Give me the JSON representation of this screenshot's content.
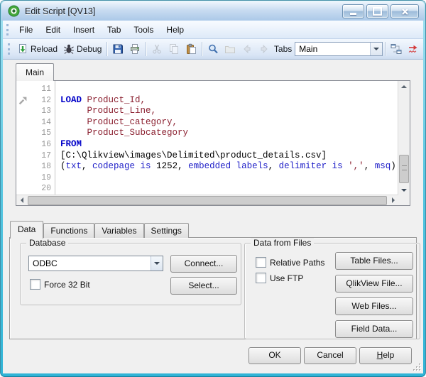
{
  "window": {
    "title": "Edit Script [QV13]",
    "controls": {
      "minimize": "minimize",
      "maximize": "maximize",
      "close": "close"
    }
  },
  "menu_bar": {
    "items": [
      "File",
      "Edit",
      "Insert",
      "Tab",
      "Tools",
      "Help"
    ]
  },
  "toolbar": {
    "groups": [
      [
        {
          "icon": "reload-icon",
          "label": "Reload",
          "enabled": true
        },
        {
          "icon": "debug-icon",
          "label": "Debug",
          "enabled": true
        }
      ],
      [
        {
          "icon": "save-icon",
          "enabled": true
        },
        {
          "icon": "print-icon",
          "enabled": true
        }
      ],
      [
        {
          "icon": "cut-icon",
          "enabled": false
        },
        {
          "icon": "copy-icon",
          "enabled": false
        },
        {
          "icon": "paste-icon",
          "enabled": true
        }
      ],
      [
        {
          "icon": "find-icon",
          "enabled": true
        },
        {
          "icon": "folder-icon",
          "enabled": false
        },
        {
          "icon": "back-icon",
          "enabled": false
        },
        {
          "icon": "forward-icon",
          "enabled": false
        }
      ]
    ],
    "tabs_label": "Tabs",
    "tab_selector_value": "Main",
    "right_icons": [
      {
        "icon": "tableviewer-icon",
        "enabled": true
      },
      {
        "icon": "syntax-check-icon",
        "enabled": true
      }
    ]
  },
  "editor": {
    "tab_label": "Main",
    "lines": [
      {
        "num": "11",
        "segments": []
      },
      {
        "num": "12",
        "bookmark": true,
        "segments": [
          {
            "t": "LOAD",
            "c": "kw"
          },
          {
            "t": " ",
            "c": "plain"
          },
          {
            "t": "Product_Id,",
            "c": "name"
          }
        ]
      },
      {
        "num": "13",
        "segments": [
          {
            "t": "     ",
            "c": "plain"
          },
          {
            "t": "Product_Line,",
            "c": "name"
          }
        ]
      },
      {
        "num": "14",
        "segments": [
          {
            "t": "     ",
            "c": "plain"
          },
          {
            "t": "Product_category,",
            "c": "name"
          }
        ]
      },
      {
        "num": "15",
        "segments": [
          {
            "t": "     ",
            "c": "plain"
          },
          {
            "t": "Product_Subcategory",
            "c": "name"
          }
        ]
      },
      {
        "num": "16",
        "segments": [
          {
            "t": "FROM",
            "c": "kw"
          }
        ]
      },
      {
        "num": "17",
        "segments": [
          {
            "t": "[C:\\Qlikview\\images\\Delimited\\product_details.csv]",
            "c": "plain"
          }
        ]
      },
      {
        "num": "18",
        "segments": [
          {
            "t": "(",
            "c": "plain"
          },
          {
            "t": "txt",
            "c": "spec"
          },
          {
            "t": ", ",
            "c": "plain"
          },
          {
            "t": "codepage is",
            "c": "spec"
          },
          {
            "t": " 1252",
            "c": "plain"
          },
          {
            "t": ", ",
            "c": "plain"
          },
          {
            "t": "embedded labels",
            "c": "spec"
          },
          {
            "t": ", ",
            "c": "plain"
          },
          {
            "t": "delimiter is",
            "c": "spec"
          },
          {
            "t": " ",
            "c": "plain"
          },
          {
            "t": "','",
            "c": "str"
          },
          {
            "t": ", ",
            "c": "plain"
          },
          {
            "t": "msq",
            "c": "spec"
          },
          {
            "t": ");",
            "c": "plain"
          }
        ]
      },
      {
        "num": "19",
        "segments": []
      },
      {
        "num": "20",
        "segments": []
      }
    ]
  },
  "panel": {
    "tabs": [
      "Data",
      "Functions",
      "Variables",
      "Settings"
    ],
    "active_tab": "Data",
    "database": {
      "label": "Database",
      "combo_value": "ODBC",
      "connect_label": "Connect...",
      "select_label": "Select...",
      "force32_label": "Force 32 Bit",
      "force32_checked": false
    },
    "files": {
      "label": "Data from Files",
      "checkboxes": [
        {
          "label": "Relative Paths",
          "checked": false
        },
        {
          "label": "Use FTP",
          "checked": false
        }
      ],
      "buttons": [
        "Table Files...",
        "QlikView File...",
        "Web Files...",
        "Field Data..."
      ]
    }
  },
  "footer": {
    "ok": "OK",
    "cancel": "Cancel",
    "help": "Help"
  },
  "colors": {
    "frame": "#4cc2de",
    "titlebar": "#bcd3ec",
    "keyword": "#0000c8",
    "identifier": "#8b2030",
    "dialog_bg": "#f0f0f0"
  }
}
